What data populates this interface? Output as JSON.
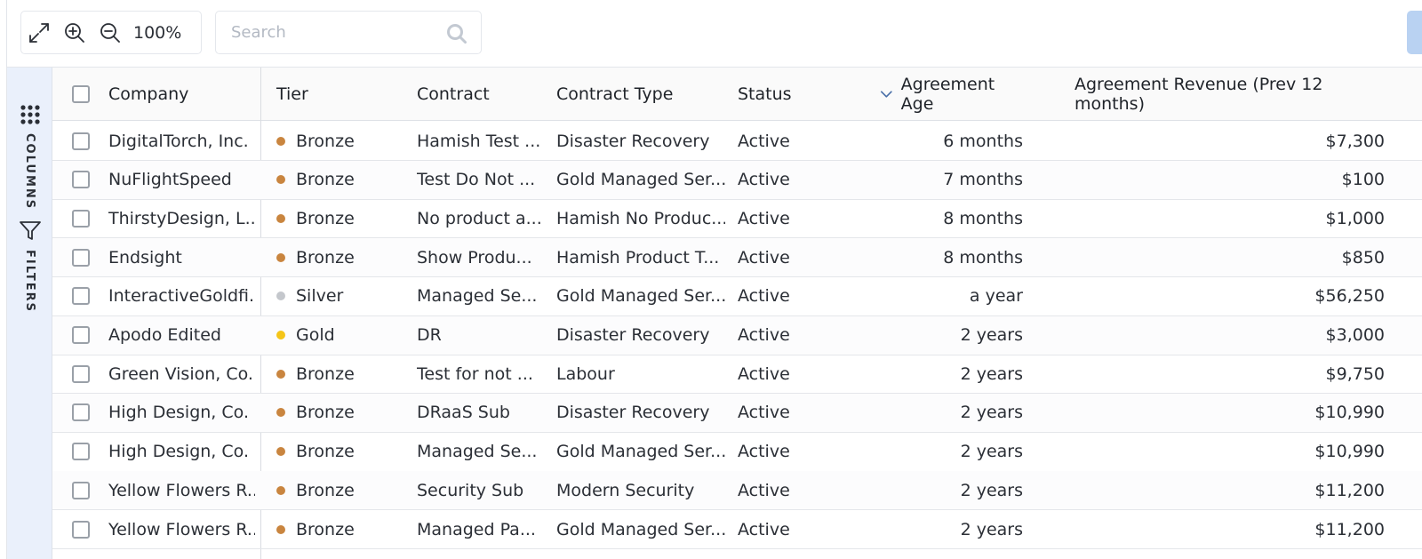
{
  "toolbar": {
    "zoom_level": "100%",
    "search_placeholder": "Search"
  },
  "side_panel": {
    "columns_label": "COLUMNS",
    "filters_label": "FILTERS"
  },
  "columns": {
    "company": "Company",
    "tier": "Tier",
    "contract": "Contract",
    "contract_type": "Contract Type",
    "status": "Status",
    "agreement_age": "Agreement Age",
    "agreement_revenue": "Agreement Revenue (Prev 12 months)"
  },
  "sort": {
    "column": "Agreement Age",
    "direction": "descending"
  },
  "tier_colors": {
    "Bronze": "#c9853f",
    "Silver": "#c4c7cc",
    "Gold": "#f5c518"
  },
  "rows": [
    {
      "company": "DigitalTorch, Inc.",
      "tier": "Bronze",
      "contract": "Hamish Test ...",
      "contract_type": "Disaster Recovery",
      "status": "Active",
      "age": "6 months",
      "revenue": "$7,300"
    },
    {
      "company": "NuFlightSpeed",
      "tier": "Bronze",
      "contract": "Test Do Not ...",
      "contract_type": "Gold Managed Ser...",
      "status": "Active",
      "age": "7 months",
      "revenue": "$100"
    },
    {
      "company": "ThirstyDesign, L...",
      "tier": "Bronze",
      "contract": "No product a...",
      "contract_type": "Hamish No Produc...",
      "status": "Active",
      "age": "8 months",
      "revenue": "$1,000"
    },
    {
      "company": "Endsight",
      "tier": "Bronze",
      "contract": "Show Produ...",
      "contract_type": "Hamish Product T...",
      "status": "Active",
      "age": "8 months",
      "revenue": "$850"
    },
    {
      "company": "InteractiveGoldfi...",
      "tier": "Silver",
      "contract": "Managed Se...",
      "contract_type": "Gold Managed Ser...",
      "status": "Active",
      "age": "a year",
      "revenue": "$56,250"
    },
    {
      "company": "Apodo Edited",
      "tier": "Gold",
      "contract": "DR",
      "contract_type": "Disaster Recovery",
      "status": "Active",
      "age": "2 years",
      "revenue": "$3,000"
    },
    {
      "company": "Green Vision, Co.",
      "tier": "Bronze",
      "contract": "Test for not ...",
      "contract_type": "Labour",
      "status": "Active",
      "age": "2 years",
      "revenue": "$9,750"
    },
    {
      "company": "High Design, Co.",
      "tier": "Bronze",
      "contract": "DRaaS Sub",
      "contract_type": "Disaster Recovery",
      "status": "Active",
      "age": "2 years",
      "revenue": "$10,990"
    },
    {
      "company": "High Design, Co.",
      "tier": "Bronze",
      "contract": "Managed Se...",
      "contract_type": "Gold Managed Ser...",
      "status": "Active",
      "age": "2 years",
      "revenue": "$10,990"
    },
    {
      "company": "Yellow Flowers R...",
      "tier": "Bronze",
      "contract": "Security Sub",
      "contract_type": "Modern Security",
      "status": "Active",
      "age": "2 years",
      "revenue": "$11,200"
    },
    {
      "company": "Yellow Flowers R...",
      "tier": "Bronze",
      "contract": "Managed Pa...",
      "contract_type": "Gold Managed Ser...",
      "status": "Active",
      "age": "2 years",
      "revenue": "$11,200"
    }
  ]
}
